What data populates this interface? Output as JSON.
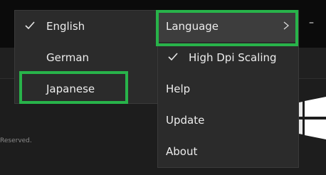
{
  "background": {
    "footer_text": "Reserved.",
    "minimize_glyph": "–"
  },
  "language_menu": {
    "items": [
      {
        "label": "English",
        "checked": true
      },
      {
        "label": "German",
        "checked": false
      },
      {
        "label": "Japanese",
        "checked": false
      }
    ]
  },
  "main_menu": {
    "items": [
      {
        "label": "Language",
        "has_submenu": true
      },
      {
        "label": "High Dpi Scaling",
        "checked": true
      },
      {
        "label": "Help"
      },
      {
        "label": "Update"
      },
      {
        "label": "About"
      }
    ]
  },
  "icons": {
    "check": "check-icon",
    "chevron": "chevron-right-icon",
    "logo": "windows-logo-icon"
  },
  "colors": {
    "highlight": "#28b34a",
    "menu_bg": "#2b2b2b",
    "hover_bg": "#3d3d3d"
  }
}
